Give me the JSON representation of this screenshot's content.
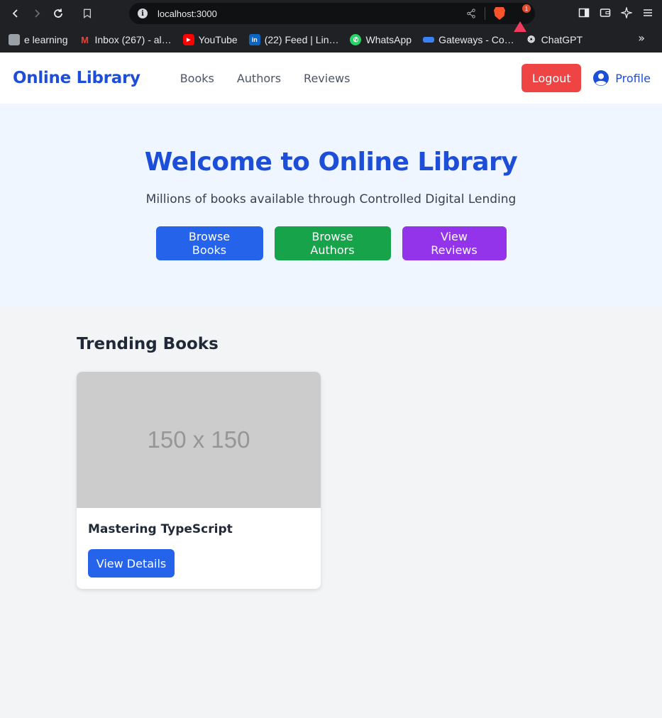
{
  "browser": {
    "url": "localhost:3000",
    "rewards_badge": "1",
    "bookmarks": [
      {
        "label": "e learning",
        "icon": "folder-icon",
        "color": "#9aa0a6"
      },
      {
        "label": "Inbox (267) - al…",
        "icon": "gmail-icon",
        "color": "#ea4335"
      },
      {
        "label": "YouTube",
        "icon": "youtube-icon",
        "color": "#ff0000"
      },
      {
        "label": "(22) Feed | Lin…",
        "icon": "linkedin-icon",
        "color": "#0a66c2"
      },
      {
        "label": "WhatsApp",
        "icon": "whatsapp-icon",
        "color": "#25d366"
      },
      {
        "label": "Gateways - Co…",
        "icon": "gateways-icon",
        "color": "#3b82f6"
      },
      {
        "label": "ChatGPT",
        "icon": "chatgpt-icon",
        "color": "#e8eaed"
      }
    ],
    "more_label": "»"
  },
  "nav": {
    "logo": "Online Library",
    "links": [
      "Books",
      "Authors",
      "Reviews"
    ],
    "logout_label": "Logout",
    "profile_label": "Profile"
  },
  "hero": {
    "title": "Welcome to Online Library",
    "subtitle": "Millions of books available through Controlled Digital Lending",
    "buttons": [
      "Browse Books",
      "Browse Authors",
      "View Reviews"
    ]
  },
  "trending": {
    "heading": "Trending Books",
    "books": [
      {
        "placeholder": "150 x 150",
        "title": "Mastering TypeScript",
        "button": "View Details"
      }
    ]
  },
  "colors": {
    "primary": "#1d4ed8",
    "logout": "#ef4444",
    "browse_books": "#2563eb",
    "browse_authors": "#16a34a",
    "view_reviews": "#9333ea",
    "hero_bg": "#eff6ff",
    "page_bg": "#f3f4f6"
  }
}
